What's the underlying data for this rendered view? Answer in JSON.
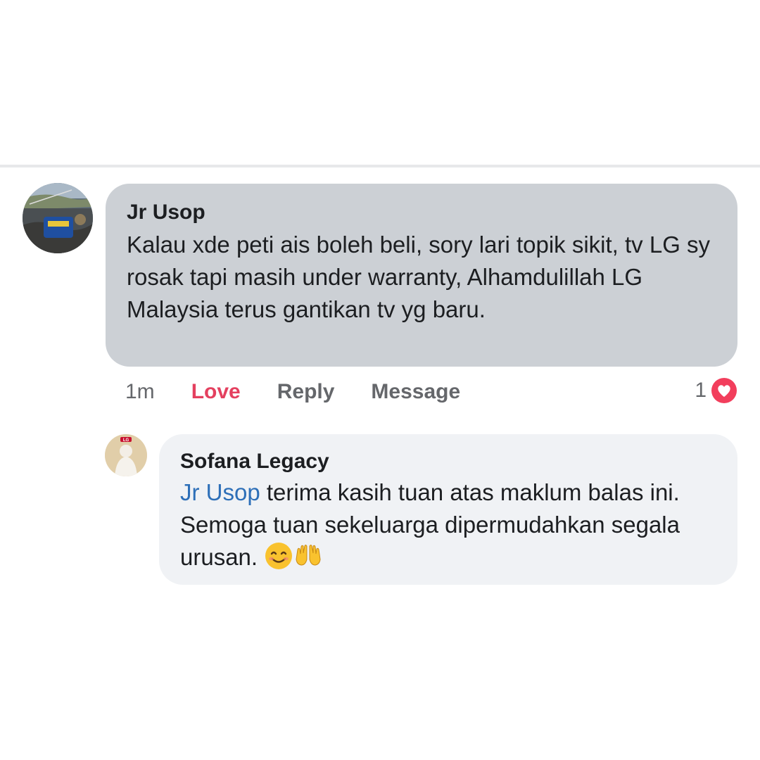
{
  "comment": {
    "author": "Jr Usop",
    "text": "Kalau xde peti ais boleh beli, sory lari topik sikit, tv LG sy rosak tapi masih under warranty, Alhamdulillah LG Malaysia terus gantikan tv yg baru.",
    "time": "1m",
    "actions": {
      "love": "Love",
      "reply": "Reply",
      "message": "Message"
    },
    "reaction_count": "1",
    "reaction_icon": "heart-icon",
    "love_color": "#e4405f"
  },
  "reply": {
    "author": "Sofana Legacy",
    "mention": "Jr Usop",
    "text": " terima kasih tuan atas maklum balas ini. Semoga tuan sekeluarga dipermudahkan segala urusan. ",
    "emojis": [
      "smiling-face-icon",
      "raising-hands-icon"
    ],
    "avatar_badge": "LG"
  },
  "colors": {
    "main_bubble": "#ccd0d5",
    "reply_bubble": "#f0f2f5",
    "mention": "#2d6fb8"
  }
}
